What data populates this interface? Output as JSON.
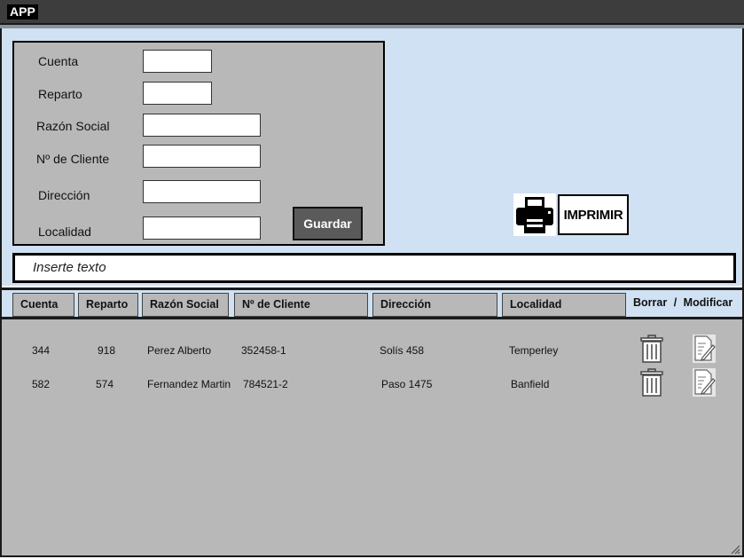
{
  "app": {
    "title": "APP"
  },
  "form": {
    "labels": {
      "cuenta": "Cuenta",
      "reparto": "Reparto",
      "razon_social": "Razón Social",
      "nro_cliente": "Nº de Cliente",
      "direccion": "Dirección",
      "localidad": "Localidad"
    },
    "values": {
      "cuenta": "",
      "reparto": "",
      "razon_social": "",
      "nro_cliente": "",
      "direccion": "",
      "localidad": ""
    },
    "save_label": "Guardar"
  },
  "print": {
    "label": "IMPRIMIR",
    "icon": "printer-icon"
  },
  "search": {
    "placeholder": "Inserte texto"
  },
  "table": {
    "headers": {
      "cuenta": "Cuenta",
      "reparto": "Reparto",
      "razon_social": "Razón Social",
      "nro_cliente": "Nº de Cliente",
      "direccion": "Dirección",
      "localidad": "Localidad",
      "borrar": "Borrar",
      "separator": "/",
      "modificar": "Modificar"
    },
    "rows": [
      {
        "cuenta": "344",
        "reparto": "918",
        "razon_social": "Perez Alberto",
        "nro_cliente": "352458-1",
        "direccion": "Solís 458",
        "localidad": "Temperley"
      },
      {
        "cuenta": "582",
        "reparto": "574",
        "razon_social": "Fernandez Martin",
        "nro_cliente": "784521-2",
        "direccion": "Paso 1475",
        "localidad": "Banfield"
      }
    ],
    "row_actions": {
      "delete_icon": "trash-icon",
      "edit_icon": "edit-document-icon"
    }
  }
}
